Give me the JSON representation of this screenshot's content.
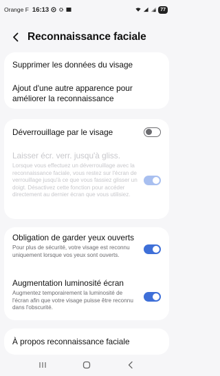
{
  "status_bar": {
    "carrier": "Orange F",
    "time": "16:13",
    "battery": "77"
  },
  "header": {
    "title": "Reconnaissance faciale"
  },
  "section1": {
    "delete_label": "Supprimer les données du visage",
    "add_appearance_label": "Ajout d'une autre apparence pour améliorer la reconnaissance"
  },
  "section2": {
    "face_unlock_label": "Déverrouillage par le visage",
    "face_unlock_enabled": false,
    "stay_on_lock_title": "Laisser écr. verr. jusqu'à gliss.",
    "stay_on_lock_desc": "Lorsque vous effectuez un déverrouillage avec la reconnaissance faciale, vous restez sur l'écran de verrouillage jusqu'à ce que vous fassiez glisser un doigt. Désactivez cette fonction pour accéder directement au dernier écran que vous utilisiez.",
    "stay_on_lock_enabled": true
  },
  "section3": {
    "eyes_open_title": "Obligation de garder yeux ouverts",
    "eyes_open_desc": "Pour plus de sécurité, votre visage est reconnu uniquement lorsque vos yeux sont ouverts.",
    "eyes_open_enabled": true,
    "brightness_title": "Augmentation luminosité écran",
    "brightness_desc": "Augmentez temporairement la luminosité de l'écran afin que votre visage puisse être reconnu dans l'obscurité.",
    "brightness_enabled": true
  },
  "section4": {
    "about_label": "À propos reconnaissance faciale"
  },
  "colors": {
    "accent": "#3e6fd8",
    "background": "#f6f6f8",
    "card": "#ffffff"
  }
}
